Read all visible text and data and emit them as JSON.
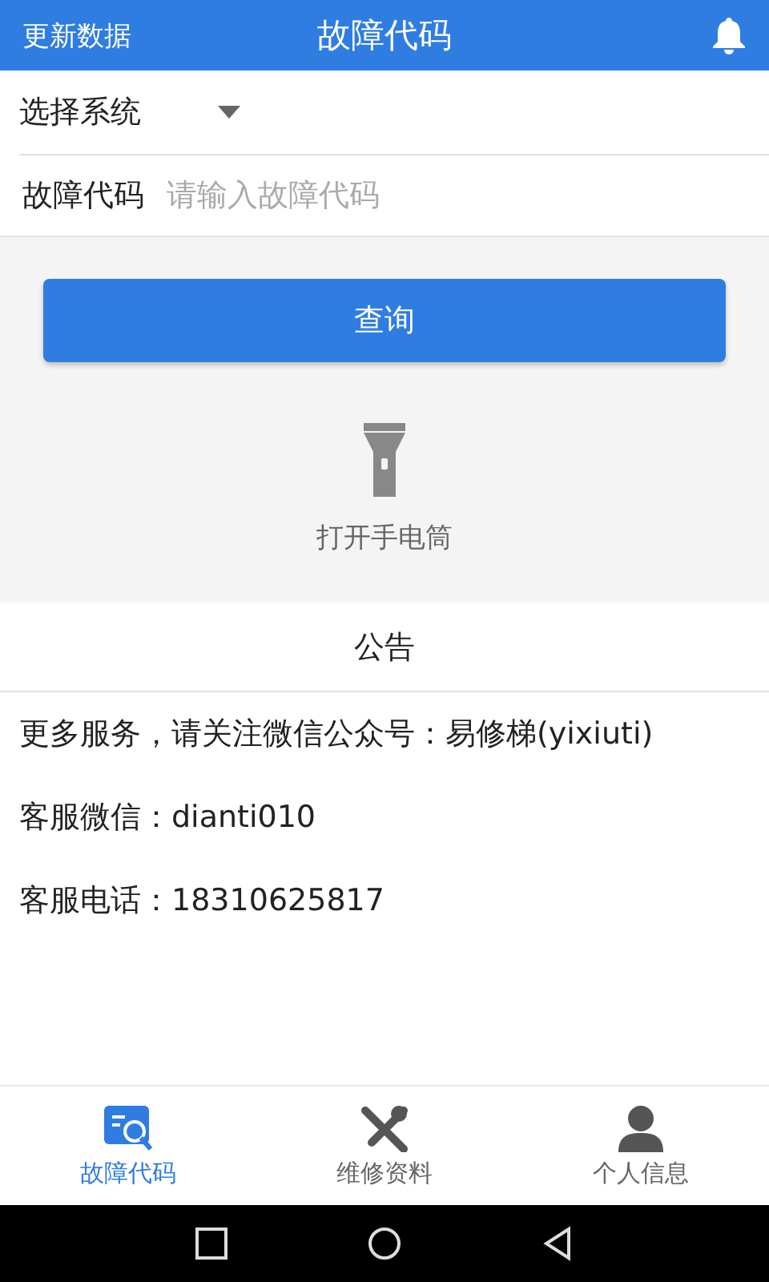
{
  "header": {
    "left_action": "更新数据",
    "title": "故障代码"
  },
  "system_select": {
    "label": "选择系统"
  },
  "code_field": {
    "label": "故障代码",
    "placeholder": "请输入故障代码"
  },
  "query_button": "查询",
  "flashlight": {
    "label": "打开手电筒"
  },
  "notice": {
    "title": "公告",
    "lines": [
      "更多服务，请关注微信公众号：易修梯(yixiuti)",
      "客服微信：dianti010",
      "客服电话：18310625817"
    ]
  },
  "tabs": [
    {
      "kind": "codes",
      "label": "故障代码",
      "selected": true
    },
    {
      "kind": "repair",
      "label": "维修资料",
      "selected": false
    },
    {
      "kind": "profile",
      "label": "个人信息",
      "selected": false
    }
  ]
}
